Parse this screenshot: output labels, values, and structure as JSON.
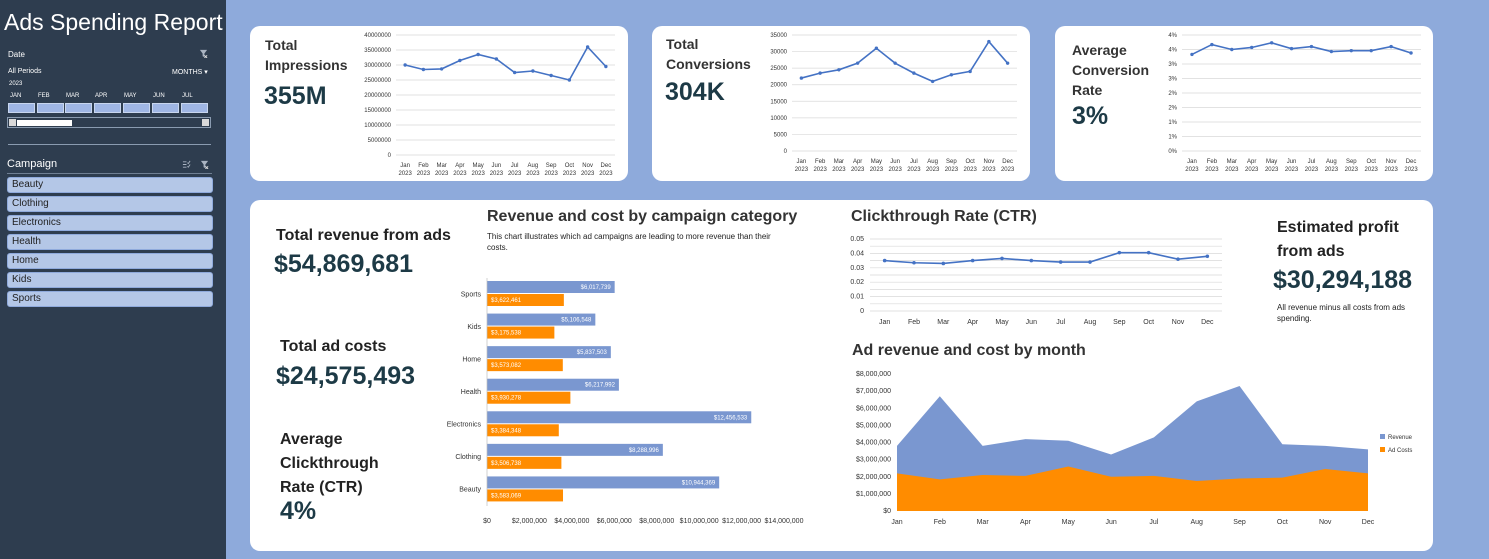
{
  "app": {
    "title": "Ads Spending Report"
  },
  "sidebar": {
    "date_label": "Date",
    "period_label": "All Periods",
    "period_unit": "MONTHS",
    "year": "2023",
    "months": [
      "JAN",
      "FEB",
      "MAR",
      "APR",
      "MAY",
      "JUN",
      "JUL"
    ],
    "campaign_label": "Campaign",
    "campaigns": [
      "Beauty",
      "Clothing",
      "Electronics",
      "Health",
      "Home",
      "Kids",
      "Sports"
    ]
  },
  "kpi": {
    "impressions": {
      "label": "Total Impressions",
      "value": "355M"
    },
    "conversions": {
      "label": "Total Conversions",
      "value": "304K"
    },
    "conv_rate": {
      "label": "Average Conversion Rate",
      "value": "3%"
    },
    "revenue": {
      "label": "Total revenue from ads",
      "value": "$54,869,681"
    },
    "costs": {
      "label": "Total ad costs",
      "value": "$24,575,493"
    },
    "ctr": {
      "label": "Average Clickthrough Rate (CTR)",
      "value": "4%"
    },
    "profit": {
      "label": "Estimated profit from ads",
      "value": "$30,294,188",
      "note": "All revenue minus all costs from ads spending."
    }
  },
  "colors": {
    "sidebar": "#2e3d4f",
    "background": "#8eaadb",
    "revenue": "#7a97d0",
    "cost": "#ff8c00",
    "line": "#4472c4",
    "value_text": "#1d3a46"
  },
  "chart_data": [
    {
      "type": "line",
      "x": [
        "Jan",
        "Feb",
        "Mar",
        "Apr",
        "May",
        "Jun",
        "Jul",
        "Aug",
        "Sep",
        "Oct",
        "Nov",
        "Dec"
      ],
      "x_sub": "2023",
      "yticks": [
        "0",
        "5000000",
        "10000000",
        "15000000",
        "20000000",
        "25000000",
        "30000000",
        "35000000",
        "40000000"
      ],
      "ylim": [
        0,
        40000000
      ],
      "series": [
        {
          "values": [
            30000000,
            28500000,
            28700000,
            31500000,
            33500000,
            32000000,
            27500000,
            28000000,
            26500000,
            25000000,
            36000000,
            29500000
          ]
        }
      ]
    },
    {
      "type": "line",
      "x": [
        "Jan",
        "Feb",
        "Mar",
        "Apr",
        "May",
        "Jun",
        "Jul",
        "Aug",
        "Sep",
        "Oct",
        "Nov",
        "Dec"
      ],
      "x_sub": "2023",
      "yticks": [
        "0",
        "5000",
        "10000",
        "15000",
        "20000",
        "25000",
        "30000",
        "35000"
      ],
      "ylim": [
        0,
        35000
      ],
      "series": [
        {
          "values": [
            22000,
            23500,
            24500,
            26500,
            31000,
            26500,
            23500,
            21000,
            23000,
            24000,
            33000,
            26500
          ]
        }
      ]
    },
    {
      "type": "line",
      "x": [
        "Jan",
        "Feb",
        "Mar",
        "Apr",
        "May",
        "Jun",
        "Jul",
        "Aug",
        "Sep",
        "Oct",
        "Nov",
        "Dec"
      ],
      "x_sub": "2023",
      "yticks": [
        "0%",
        "1%",
        "1%",
        "2%",
        "2%",
        "3%",
        "3%",
        "4%",
        "4%"
      ],
      "ylim": [
        0,
        0.04
      ],
      "series": [
        {
          "values": [
            0.0333,
            0.0367,
            0.035,
            0.0357,
            0.0373,
            0.0353,
            0.036,
            0.0343,
            0.0346,
            0.0346,
            0.036,
            0.0338
          ]
        }
      ]
    },
    {
      "type": "bar",
      "title": "Revenue and cost by campaign category",
      "subtitle": "This chart illustrates which ad campaigns are leading to more revenue than their costs.",
      "categories": [
        "Sports",
        "Kids",
        "Home",
        "Health",
        "Electronics",
        "Clothing",
        "Beauty"
      ],
      "series": [
        {
          "values": [
            6017739,
            5106548,
            5837503,
            6217992,
            12456533,
            8288996,
            10944369
          ],
          "labels": [
            "$6,017,739",
            "$5,106,548",
            "$5,837,503",
            "$6,217,992",
            "$12,456,533",
            "$8,288,996",
            "$10,944,369"
          ]
        },
        {
          "values": [
            3622461,
            3175538,
            3573082,
            3930278,
            3384348,
            3506738,
            3583069
          ],
          "labels": [
            "$3,622,461",
            "$3,175,538",
            "$3,573,082",
            "$3,930,278",
            "$3,384,348",
            "$3,506,738",
            "$3,583,069"
          ]
        }
      ],
      "xticks": [
        "$0",
        "$2,000,000",
        "$4,000,000",
        "$6,000,000",
        "$8,000,000",
        "$10,000,000",
        "$12,000,000",
        "$14,000,000"
      ],
      "xlim": [
        0,
        14000000
      ]
    },
    {
      "type": "line",
      "title": "Clickthrough Rate (CTR)",
      "x": [
        "Jan",
        "Feb",
        "Mar",
        "Apr",
        "May",
        "Jun",
        "Jul",
        "Aug",
        "Sep",
        "Oct",
        "Nov",
        "Dec"
      ],
      "yticks": [
        "0",
        "0.005",
        "0.01",
        "0.015",
        "0.02",
        "0.025",
        "0.03",
        "0.035",
        "0.04",
        "0.045",
        "0.05"
      ],
      "ylim": [
        0,
        0.05
      ],
      "series": [
        {
          "values": [
            0.035,
            0.0335,
            0.033,
            0.035,
            0.0365,
            0.035,
            0.034,
            0.034,
            0.0405,
            0.0405,
            0.036,
            0.038
          ]
        }
      ]
    },
    {
      "type": "area",
      "title": "Ad revenue and cost by month",
      "x": [
        "Jan",
        "Feb",
        "Mar",
        "Apr",
        "May",
        "Jun",
        "Jul",
        "Aug",
        "Sep",
        "Oct",
        "Nov",
        "Dec"
      ],
      "yticks": [
        "$0",
        "$1,000,000",
        "$2,000,000",
        "$3,000,000",
        "$4,000,000",
        "$5,000,000",
        "$6,000,000",
        "$7,000,000",
        "$8,000,000"
      ],
      "ylim": [
        0,
        8000000
      ],
      "legend": "right",
      "series": [
        {
          "name": "Revenue",
          "values": [
            3800000,
            6700000,
            3800000,
            4200000,
            4100000,
            3300000,
            4300000,
            6400000,
            7300000,
            3900000,
            3800000,
            3600000
          ]
        },
        {
          "name": "Ad Costs",
          "values": [
            2200000,
            1850000,
            2100000,
            2050000,
            2600000,
            2000000,
            2050000,
            1750000,
            1900000,
            1950000,
            2450000,
            2200000
          ]
        }
      ]
    }
  ]
}
